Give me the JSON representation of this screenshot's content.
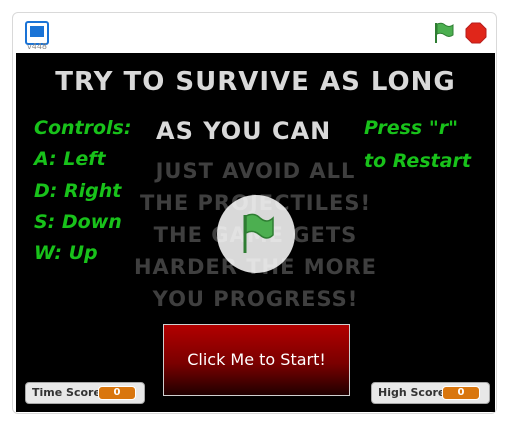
{
  "player": {
    "version": "v448",
    "icons": [
      "fullscreen-icon",
      "green-flag-icon",
      "stop-icon"
    ],
    "colors": {
      "flag": "#4caf50",
      "stop": "#e0261a",
      "stage_bg": "#000000",
      "controls_text": "#18c21a"
    }
  },
  "stage": {
    "title_line1": "TRY TO SURVIVE AS LONG",
    "title_line2": "AS YOU CAN",
    "controls": {
      "heading": "Controls:",
      "items": [
        "A: Left",
        "D: Right",
        "S: Down",
        "W: Up"
      ]
    },
    "restart": {
      "line1": "Press \"r\"",
      "line2": "to Restart"
    },
    "instructions": [
      "JUST AVOID ALL",
      "THE PROJECTILES!",
      "THE GAME GETS",
      "HARDER THE MORE",
      "YOU PROGRESS!"
    ],
    "start_button": "Click Me to Start!"
  },
  "monitors": [
    {
      "label": "Time Score",
      "value": "0"
    },
    {
      "label": "High Score",
      "value": "0"
    }
  ]
}
